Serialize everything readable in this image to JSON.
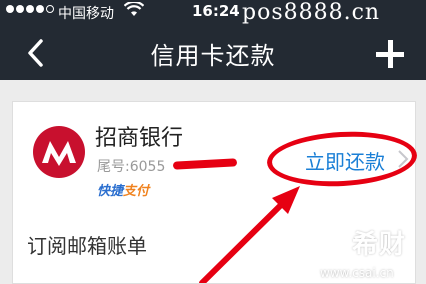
{
  "status_bar": {
    "carrier": "中国移动",
    "time": "16:24",
    "watermark": "pos8888.cn"
  },
  "nav": {
    "title": "信用卡还款"
  },
  "card": {
    "bank_name": "招商银行",
    "tail_label": "尾号:6055",
    "quick_pay": [
      "快捷",
      "支付"
    ],
    "repay_button": "立即还款"
  },
  "mail": {
    "label": "订阅邮箱账单"
  },
  "brand": {
    "name": "希财",
    "url": "www.csai.cn"
  },
  "colors": {
    "nav_bg": "#232a33",
    "accent_blue": "#1a7fd6",
    "annotation_red": "#e60012"
  }
}
